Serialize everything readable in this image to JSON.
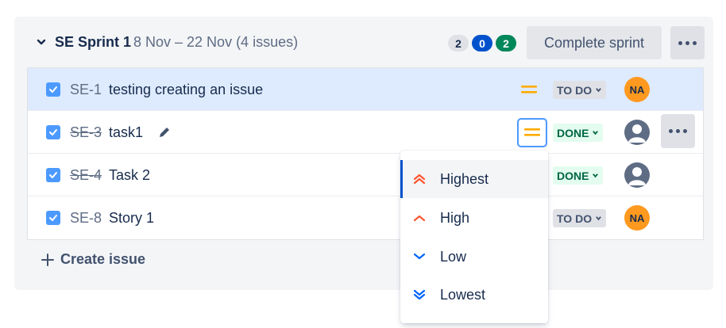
{
  "sprint": {
    "title": "SE Sprint 1",
    "dates": "8 Nov – 22 Nov  (4 issues)",
    "counts": {
      "todo": "2",
      "in_progress": "0",
      "done": "2"
    },
    "complete_label": "Complete sprint"
  },
  "issues": [
    {
      "key": "SE-1",
      "summary": "testing creating an issue",
      "status": "TO DO",
      "assignee": "NA",
      "priority": "medium-icon",
      "selected": true
    },
    {
      "key": "SE-3",
      "summary": "task1",
      "status": "DONE",
      "assignee": "",
      "priority": "medium-icon"
    },
    {
      "key": "SE-4",
      "summary": "Task 2",
      "status": "DONE",
      "assignee": ""
    },
    {
      "key": "SE-8",
      "summary": "Story 1",
      "status": "TO DO",
      "assignee": "NA"
    }
  ],
  "create_label": "Create issue",
  "priority_menu": [
    {
      "label": "Highest",
      "icon": "highest-priority-icon"
    },
    {
      "label": "High",
      "icon": "high-priority-icon"
    },
    {
      "label": "Low",
      "icon": "low-priority-icon"
    },
    {
      "label": "Lowest",
      "icon": "lowest-priority-icon"
    }
  ],
  "colors": {
    "accent": "#0052cc",
    "checkbox": "#4c9aff",
    "priority_medium": "#ffab00",
    "priority_high": "#ff5630",
    "priority_low": "#0065ff",
    "done_bg": "#e3fcef",
    "assignee": "#ff991f"
  }
}
